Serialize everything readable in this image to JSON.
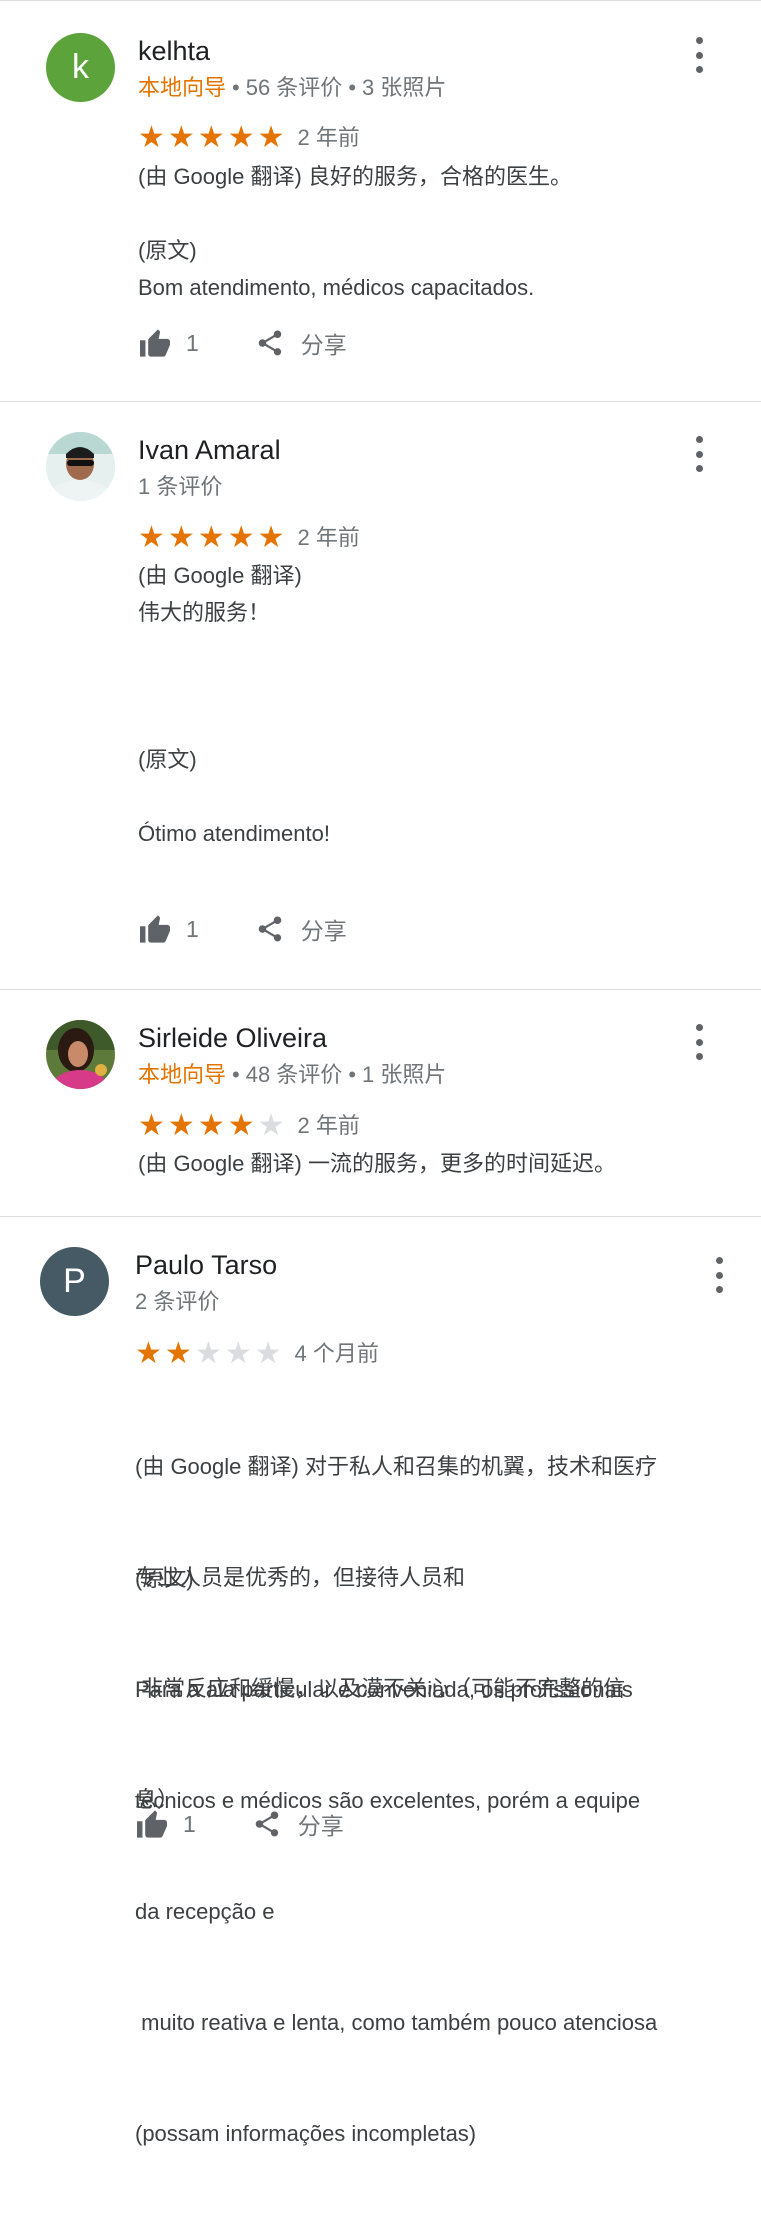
{
  "colors": {
    "star": "#e37400",
    "star_empty": "#dadce0",
    "local_guide": "#e37400",
    "avatar_k": "#5ba33a",
    "avatar_p": "#455a64"
  },
  "reviews": [
    {
      "avatar_letter": "k",
      "name": "kelhta",
      "local_guide": "本地向导",
      "review_count": "56 条评价",
      "photo_count": "3 张照片",
      "rating": 5,
      "age": "2 年前",
      "translated_label": "(由 Google 翻译)",
      "translated_text": "良好的服务，合格的医生。",
      "original_label": "(原文)",
      "original_text": "Bom atendimento, médicos capacitados.",
      "likes": "1",
      "share_label": "分享"
    },
    {
      "name": "Ivan Amaral",
      "review_count": "1 条评价",
      "rating": 5,
      "age": "2 年前",
      "translated_label": "(由 Google 翻译)",
      "translated_text": "伟大的服务！",
      "original_label": "(原文)",
      "original_text": "Ótimo atendimento!",
      "likes": "1",
      "share_label": "分享"
    },
    {
      "name": "Sirleide Oliveira",
      "local_guide": "本地向导",
      "review_count": "48 条评价",
      "photo_count": "1 张照片",
      "rating": 4,
      "age": "2 年前",
      "translated_label": "(由 Google 翻译)",
      "translated_text": "一流的服务，更多的时间延迟。"
    },
    {
      "avatar_letter": "P",
      "name": "Paulo Tarso",
      "review_count": "2 条评价",
      "rating": 2,
      "age": "4 个月前",
      "translated_label": "(由 Google 翻译)",
      "translated_lines": [
        "对于私人和召集的机翼，技术和医疗",
        "专业人员是优秀的，但接待人员和",
        " 非常反应和缓慢，以及漠不关心（可能不完整的信",
        "息）"
      ],
      "original_label": "(原文)",
      "original_lines": [
        "Para a ala particular e conveniada, os profissionais",
        "técnicos e médicos são excelentes, porém a equipe",
        "da recepção e",
        " muito reativa e lenta, como também pouco atenciosa",
        "(possam informações incompletas)"
      ],
      "likes": "1",
      "share_label": "分享"
    }
  ]
}
